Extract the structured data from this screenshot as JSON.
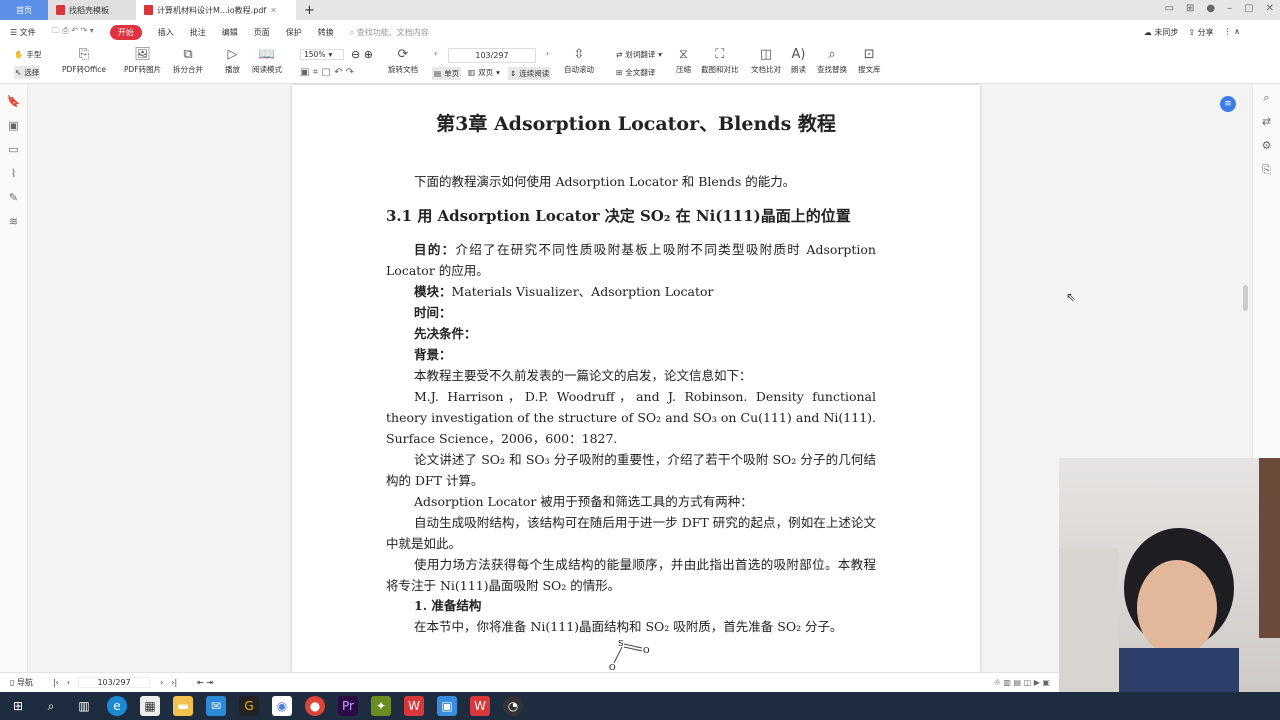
{
  "tabs": {
    "home": "首页",
    "t1": "找稻壳模板",
    "t2": "计算机材料设计M...io教程.pdf"
  },
  "menu": {
    "file": "文件",
    "items": [
      "开始",
      "插入",
      "批注",
      "编辑",
      "页面",
      "保护",
      "转换"
    ],
    "search_placeholder": "查找功能、文档内容",
    "sync": "未同步",
    "share": "分享"
  },
  "toolbar": {
    "hand": "手型",
    "select": "选择",
    "pdf_office": "PDF转Office",
    "pdf_img": "PDF转图片",
    "split": "拆分合并",
    "play": "播放",
    "read_mode": "阅读模式",
    "zoom": "150%",
    "page": "103/297",
    "rotate": "旋转文档",
    "single": "单页",
    "double": "双页",
    "continuous": "连续阅读",
    "auto_scroll": "自动滚动",
    "word_translate": "划词翻译",
    "full_translate": "全文翻译",
    "compress": "压缩",
    "screenshot": "截图和对比",
    "compare": "文档比对",
    "read_aloud": "朗读",
    "find_replace": "查找替换",
    "search_lib": "搜文库"
  },
  "doc": {
    "title": "第3章 Adsorption Locator、Blends 教程",
    "intro": "下面的教程演示如何使用 Adsorption Locator 和 Blends 的能力。",
    "section": "3.1 用 Adsorption Locator 决定 SO₂ 在 Ni(111)晶面上的位置",
    "purpose_label": "目的：",
    "purpose": "介绍了在研究不同性质吸附基板上吸附不同类型吸附质时 Adsorption Locator 的应用。",
    "module_label": "模块：",
    "module": "Materials Visualizer、Adsorption Locator",
    "time_label": "时间：",
    "prereq_label": "先决条件：",
    "bg_label": "背景：",
    "p1": "本教程主要受不久前发表的一篇论文的启发，论文信息如下：",
    "p2": "M.J. Harrison，D.P. Woodruff，and J. Robinson. Density functional theory investigation of the structure of SO₂ and SO₃ on Cu(111) and Ni(111). Surface Science，2006，600：1827.",
    "p3": "论文讲述了 SO₂ 和 SO₃ 分子吸附的重要性，介绍了若干个吸附 SO₂ 分子的几何结构的 DFT 计算。",
    "p4": "Adsorption Locator 被用于预备和筛选工具的方式有两种：",
    "p5": "自动生成吸附结构，该结构可在随后用于进一步 DFT 研究的起点，例如在上述论文中就是如此。",
    "p6": "使用力场方法获得每个生成结构的能量顺序，并由此指出首选的吸附部位。本教程将专注于 Ni(111)晶面吸附 SO₂ 的情形。",
    "step1": "1.  准备结构",
    "p7": "在本节中，你将准备 Ni(111)晶面结构和 SO₂ 吸附质，首先准备 SO₂ 分子。",
    "mol_s": "S",
    "mol_o1": "O",
    "mol_o2": "O"
  },
  "status": {
    "nav": "导航",
    "page": "103/297"
  }
}
